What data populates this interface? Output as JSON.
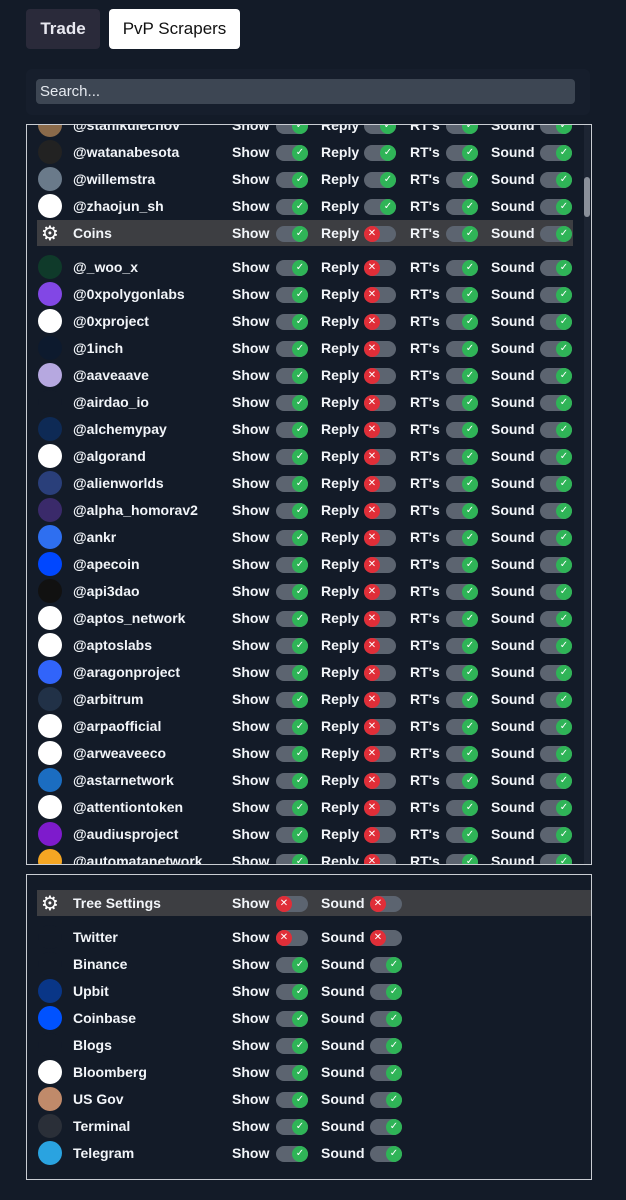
{
  "tabs": {
    "trade": "Trade",
    "pvp": "PvP Scrapers"
  },
  "search": {
    "placeholder": "Search..."
  },
  "labels": {
    "show": "Show",
    "reply": "Reply",
    "rts": "RT's",
    "sound": "Sound"
  },
  "coins": {
    "rows": [
      {
        "name": "@stanikulechov",
        "show": true,
        "reply": true,
        "rts": true,
        "sound": true,
        "icon": "avatar-icon",
        "color": "#8a6a4a"
      },
      {
        "name": "@watanabesota",
        "show": true,
        "reply": true,
        "rts": true,
        "sound": true,
        "icon": "avatar-icon",
        "color": "#222222"
      },
      {
        "name": "@willemstra",
        "show": true,
        "reply": true,
        "rts": true,
        "sound": true,
        "icon": "avatar-icon",
        "color": "#6a7a8a"
      },
      {
        "name": "@zhaojun_sh",
        "show": true,
        "reply": true,
        "rts": true,
        "sound": true,
        "icon": "zj-logo-icon",
        "color": "#ffffff"
      },
      {
        "name": "Coins",
        "header": true,
        "show": true,
        "reply": false,
        "rts": true,
        "sound": true,
        "icon": "gear-icon",
        "color": "#ffffff"
      },
      {
        "name": "@_woo_x",
        "show": true,
        "reply": false,
        "rts": true,
        "sound": true,
        "icon": "woo-logo-icon",
        "color": "#0f3a2a"
      },
      {
        "name": "@0xpolygonlabs",
        "show": true,
        "reply": false,
        "rts": true,
        "sound": true,
        "icon": "polygon-logo-icon",
        "color": "#8247e5"
      },
      {
        "name": "@0xproject",
        "show": true,
        "reply": false,
        "rts": true,
        "sound": true,
        "icon": "0x-logo-icon",
        "color": "#ffffff"
      },
      {
        "name": "@1inch",
        "show": true,
        "reply": false,
        "rts": true,
        "sound": true,
        "icon": "1inch-logo-icon",
        "color": "#0d1a2e"
      },
      {
        "name": "@aaveaave",
        "show": true,
        "reply": false,
        "rts": true,
        "sound": true,
        "icon": "aave-logo-icon",
        "color": "#b6a8e0"
      },
      {
        "name": "@airdao_io",
        "show": true,
        "reply": false,
        "rts": true,
        "sound": true,
        "icon": "airdao-logo-icon",
        "color": "#131b28"
      },
      {
        "name": "@alchemypay",
        "show": true,
        "reply": false,
        "rts": true,
        "sound": true,
        "icon": "alchemypay-logo-icon",
        "color": "#0e2a55"
      },
      {
        "name": "@algorand",
        "show": true,
        "reply": false,
        "rts": true,
        "sound": true,
        "icon": "algorand-logo-icon",
        "color": "#ffffff"
      },
      {
        "name": "@alienworlds",
        "show": true,
        "reply": false,
        "rts": true,
        "sound": true,
        "icon": "alienworlds-logo-icon",
        "color": "#2a3f7a"
      },
      {
        "name": "@alpha_homorav2",
        "show": true,
        "reply": false,
        "rts": true,
        "sound": true,
        "icon": "alpha-logo-icon",
        "color": "#3a2a6a"
      },
      {
        "name": "@ankr",
        "show": true,
        "reply": false,
        "rts": true,
        "sound": true,
        "icon": "ankr-logo-icon",
        "color": "#2e6ff0"
      },
      {
        "name": "@apecoin",
        "show": true,
        "reply": false,
        "rts": true,
        "sound": true,
        "icon": "apecoin-logo-icon",
        "color": "#0047ff"
      },
      {
        "name": "@api3dao",
        "show": true,
        "reply": false,
        "rts": true,
        "sound": true,
        "icon": "api3-logo-icon",
        "color": "#111111"
      },
      {
        "name": "@aptos_network",
        "show": true,
        "reply": false,
        "rts": true,
        "sound": true,
        "icon": "aptos-logo-icon",
        "color": "#ffffff"
      },
      {
        "name": "@aptoslabs",
        "show": true,
        "reply": false,
        "rts": true,
        "sound": true,
        "icon": "aptoslabs-logo-icon",
        "color": "#ffffff"
      },
      {
        "name": "@aragonproject",
        "show": true,
        "reply": false,
        "rts": true,
        "sound": true,
        "icon": "aragon-logo-icon",
        "color": "#3164fa"
      },
      {
        "name": "@arbitrum",
        "show": true,
        "reply": false,
        "rts": true,
        "sound": true,
        "icon": "arbitrum-logo-icon",
        "color": "#213147"
      },
      {
        "name": "@arpaofficial",
        "show": true,
        "reply": false,
        "rts": true,
        "sound": true,
        "icon": "arpa-logo-icon",
        "color": "#ffffff"
      },
      {
        "name": "@arweaveeco",
        "show": true,
        "reply": false,
        "rts": true,
        "sound": true,
        "icon": "arweave-logo-icon",
        "color": "#ffffff"
      },
      {
        "name": "@astarnetwork",
        "show": true,
        "reply": false,
        "rts": true,
        "sound": true,
        "icon": "astar-logo-icon",
        "color": "#1b6dc1"
      },
      {
        "name": "@attentiontoken",
        "show": true,
        "reply": false,
        "rts": true,
        "sound": true,
        "icon": "bat-logo-icon",
        "color": "#ffffff"
      },
      {
        "name": "@audiusproject",
        "show": true,
        "reply": false,
        "rts": true,
        "sound": true,
        "icon": "audius-logo-icon",
        "color": "#7e1bcc"
      },
      {
        "name": "@automatanetwork",
        "show": true,
        "reply": false,
        "rts": true,
        "sound": true,
        "icon": "automata-logo-icon",
        "color": "#f5a623"
      }
    ]
  },
  "tree": {
    "rows": [
      {
        "name": "Tree Settings",
        "header": true,
        "show": false,
        "sound": false,
        "icon": "gear-icon",
        "color": "#ffffff"
      },
      {
        "name": "Twitter",
        "show": false,
        "sound": false,
        "icon": "twitter-bird-icon",
        "color": "#131b28"
      },
      {
        "name": "Binance",
        "show": true,
        "sound": true,
        "icon": "binance-logo-icon",
        "color": "#131b28"
      },
      {
        "name": "Upbit",
        "show": true,
        "sound": true,
        "icon": "upbit-logo-icon",
        "color": "#093687"
      },
      {
        "name": "Coinbase",
        "show": true,
        "sound": true,
        "icon": "coinbase-logo-icon",
        "color": "#0052ff"
      },
      {
        "name": "Blogs",
        "show": true,
        "sound": true,
        "icon": "blog-icon",
        "color": "#131b28"
      },
      {
        "name": "Bloomberg",
        "show": true,
        "sound": true,
        "icon": "bloomberg-logo-icon",
        "color": "#ffffff"
      },
      {
        "name": "US Gov",
        "show": true,
        "sound": true,
        "icon": "avatar-icon",
        "color": "#c08a6a"
      },
      {
        "name": "Terminal",
        "show": true,
        "sound": true,
        "icon": "terminal-icon",
        "color": "#2a2f38"
      },
      {
        "name": "Telegram",
        "show": true,
        "sound": true,
        "icon": "telegram-logo-icon",
        "color": "#2aa3e0"
      }
    ]
  }
}
